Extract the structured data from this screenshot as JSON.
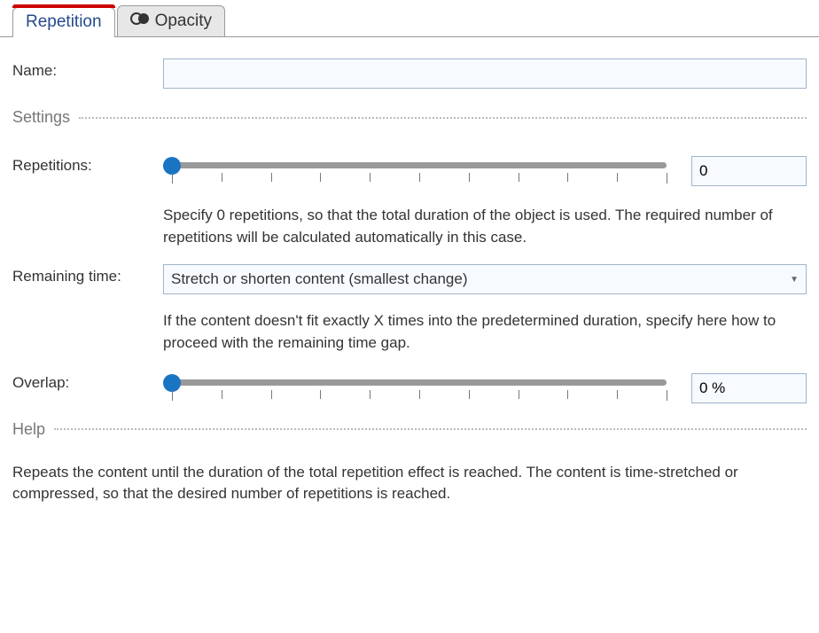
{
  "tabs": {
    "repetition": "Repetition",
    "opacity": "Opacity"
  },
  "name": {
    "label": "Name:",
    "value": ""
  },
  "settings_header": "Settings",
  "repetitions": {
    "label": "Repetitions:",
    "value": "0",
    "help": "Specify 0 repetitions, so that the total duration of the object is used. The required number of repetitions will be calculated automatically in this case."
  },
  "remaining_time": {
    "label": "Remaining time:",
    "value": "Stretch or shorten content (smallest change)",
    "help": "If the content doesn't fit exactly X times into the predetermined duration, specify here how to proceed with the remaining time gap."
  },
  "overlap": {
    "label": "Overlap:",
    "value": "0 %"
  },
  "help_header": "Help",
  "help_body": "Repeats the content until the duration of the total repetition effect is reached. The content is time-stretched or compressed, so that the desired number of repetitions is reached."
}
